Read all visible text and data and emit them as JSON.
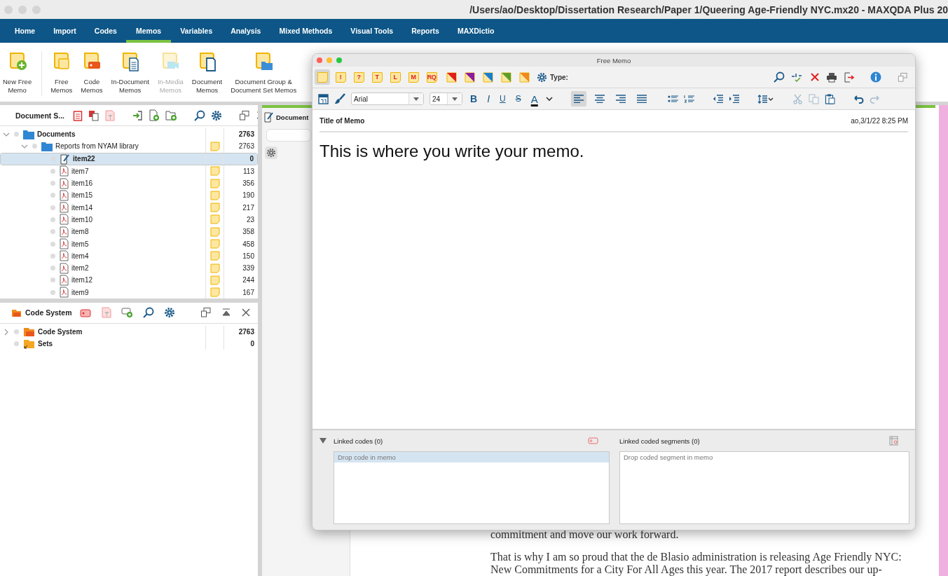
{
  "window": {
    "title": "/Users/ao/Desktop/Dissertation Research/Paper 1/Queering Age-Friendly NYC.mx20 - MAXQDA Plus 20"
  },
  "menu_tabs": [
    {
      "label": "Home",
      "selected": false
    },
    {
      "label": "Import",
      "selected": false
    },
    {
      "label": "Codes",
      "selected": false
    },
    {
      "label": "Memos",
      "selected": true
    },
    {
      "label": "Variables",
      "selected": false
    },
    {
      "label": "Analysis",
      "selected": false
    },
    {
      "label": "Mixed Methods",
      "selected": false
    },
    {
      "label": "Visual Tools",
      "selected": false
    },
    {
      "label": "Reports",
      "selected": false
    },
    {
      "label": "MAXDictio",
      "selected": false
    }
  ],
  "ribbon": [
    {
      "kind": "new",
      "lines": [
        "New Free",
        "Memo"
      ],
      "disabled": false
    },
    {
      "kind": "free",
      "lines": [
        "Free",
        "Memos"
      ],
      "disabled": false
    },
    {
      "kind": "code",
      "lines": [
        "Code",
        "Memos"
      ],
      "disabled": false
    },
    {
      "kind": "in_document",
      "lines": [
        "In-Document",
        "Memos"
      ],
      "disabled": false
    },
    {
      "kind": "in_media",
      "lines": [
        "In-Media",
        "Memos"
      ],
      "disabled": true
    },
    {
      "kind": "document",
      "lines": [
        "Document",
        "Memos"
      ],
      "disabled": false
    },
    {
      "kind": "group",
      "lines": [
        "Document Group &",
        "Document Set Memos"
      ],
      "disabled": false
    }
  ],
  "document_system": {
    "title": "Document S...",
    "tree": [
      {
        "label": "Documents",
        "kind": "root",
        "count": "2763",
        "expanded": true,
        "memo": false,
        "selected": false,
        "children": [
          {
            "label": "Reports from NYAM library",
            "kind": "folder",
            "count": "2763",
            "expanded": true,
            "memo": true,
            "selected": false,
            "children": [
              {
                "label": "item22",
                "kind": "text",
                "count": "0",
                "memo": false,
                "selected": true
              },
              {
                "label": "item7",
                "kind": "pdf",
                "count": "113",
                "memo": true,
                "selected": false
              },
              {
                "label": "item16",
                "kind": "pdf",
                "count": "356",
                "memo": true,
                "selected": false
              },
              {
                "label": "item15",
                "kind": "pdf",
                "count": "190",
                "memo": true,
                "selected": false
              },
              {
                "label": "item14",
                "kind": "pdf",
                "count": "217",
                "memo": true,
                "selected": false
              },
              {
                "label": "item10",
                "kind": "pdf",
                "count": "23",
                "memo": true,
                "selected": false
              },
              {
                "label": "item8",
                "kind": "pdf",
                "count": "358",
                "memo": true,
                "selected": false
              },
              {
                "label": "item5",
                "kind": "pdf",
                "count": "458",
                "memo": true,
                "selected": false
              },
              {
                "label": "item4",
                "kind": "pdf",
                "count": "150",
                "memo": true,
                "selected": false
              },
              {
                "label": "item2",
                "kind": "pdf",
                "count": "339",
                "memo": true,
                "selected": false
              },
              {
                "label": "item12",
                "kind": "pdf",
                "count": "244",
                "memo": true,
                "selected": false
              },
              {
                "label": "item9",
                "kind": "pdf",
                "count": "167",
                "memo": true,
                "selected": false
              }
            ]
          }
        ]
      }
    ]
  },
  "code_system": {
    "title": "Code System",
    "tree": [
      {
        "label": "Code System",
        "kind": "codes",
        "count": "2763",
        "expanded": false,
        "memo": false,
        "selected": false
      },
      {
        "label": "Sets",
        "kind": "sets",
        "count": "0",
        "memo": false,
        "selected": false
      }
    ]
  },
  "document_browser": {
    "title": "Document"
  },
  "document_paragraphs": [
    [
      "commitment and move our work forward."
    ],
    [
      "That is why I am so proud that the de Blasio administration is releasing Age Friendly NYC:",
      "New Commitments for a City For All Ages this year. The 2017 report describes our up-"
    ]
  ],
  "memo_window": {
    "title": "Free Memo",
    "memo_types": [
      {
        "kind": "plain",
        "selected": true
      },
      {
        "kind": "letter",
        "glyph": "!",
        "selected": false
      },
      {
        "kind": "letter",
        "glyph": "?",
        "selected": false
      },
      {
        "kind": "letter",
        "glyph": "T",
        "selected": false
      },
      {
        "kind": "letter",
        "glyph": "L",
        "selected": false
      },
      {
        "kind": "letter",
        "glyph": "M",
        "selected": false
      },
      {
        "kind": "letter",
        "glyph": "RQ",
        "selected": false
      },
      {
        "kind": "color",
        "color": "#e0201b",
        "selected": false
      },
      {
        "kind": "color",
        "color": "#8e1a9c",
        "selected": false
      },
      {
        "kind": "color",
        "color": "#1a7fd0",
        "selected": false
      },
      {
        "kind": "color",
        "color": "#5aa02c",
        "selected": false
      },
      {
        "kind": "color",
        "color": "#f08a1c",
        "selected": false
      }
    ],
    "type_label": "Type:",
    "font": "Arial",
    "size": "24",
    "format_buttons": [
      {
        "kind": "bold",
        "glyph": "B"
      },
      {
        "kind": "italic",
        "glyph": "I"
      },
      {
        "kind": "underline",
        "glyph": "U"
      },
      {
        "kind": "strike",
        "glyph": "S"
      },
      {
        "kind": "color",
        "glyph": "A"
      }
    ],
    "align_buttons": [
      {
        "kind": "left",
        "selected": true
      },
      {
        "kind": "center",
        "selected": false
      },
      {
        "kind": "right",
        "selected": false
      },
      {
        "kind": "justify",
        "selected": false
      }
    ],
    "edit_actions": [
      {
        "kind": "cut",
        "disabled": true
      },
      {
        "kind": "copy",
        "disabled": true
      },
      {
        "kind": "paste",
        "disabled": false
      },
      {
        "kind": "undo",
        "disabled": false
      },
      {
        "kind": "redo",
        "disabled": true
      }
    ],
    "memo_title": "Title of Memo",
    "author_date": "ao,3/1/22 8:25 PM",
    "body": "This is where you write your memo.",
    "links_expanded": true,
    "linked_codes": {
      "title": "Linked codes (0)",
      "placeholder": "Drop code in memo"
    },
    "linked_segments": {
      "title": "Linked coded segments (0)",
      "placeholder": "Drop coded segment in memo"
    }
  }
}
